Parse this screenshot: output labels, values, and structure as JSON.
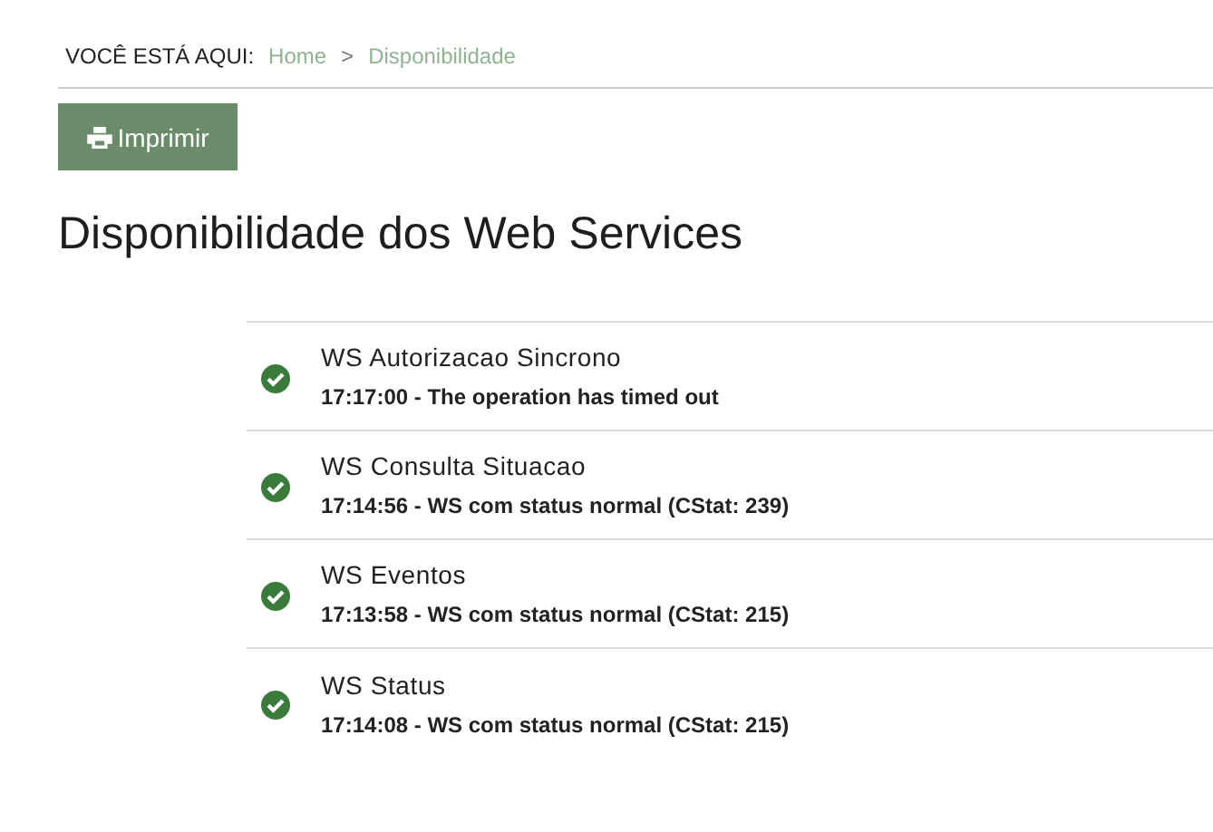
{
  "breadcrumb": {
    "label": "VOCÊ ESTÁ AQUI:",
    "items": [
      {
        "text": "Home"
      },
      {
        "text": "Disponibilidade"
      }
    ],
    "separator": ">"
  },
  "print_button": {
    "label": "Imprimir"
  },
  "title": "Disponibilidade dos Web Services",
  "services": [
    {
      "name": "WS Autorizacao Sincrono",
      "ok": true,
      "message": "17:17:00 - The operation has timed out"
    },
    {
      "name": "WS Consulta Situacao",
      "ok": true,
      "message": "17:14:56 - WS com status normal (CStat: 239)"
    },
    {
      "name": "WS Eventos",
      "ok": true,
      "message": "17:13:58 - WS com status normal (CStat: 215)"
    },
    {
      "name": "WS Status",
      "ok": true,
      "message": "17:14:08 - WS com status normal (CStat: 215)"
    }
  ]
}
